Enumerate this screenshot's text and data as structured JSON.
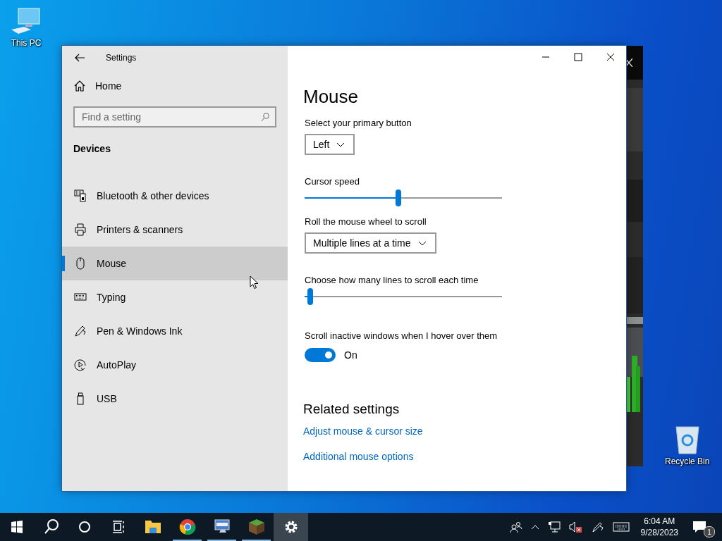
{
  "desktop_icons": [
    {
      "label": "This PC"
    },
    {
      "label": "Recycle Bin"
    }
  ],
  "window": {
    "title": "Settings",
    "home": "Home",
    "search": {
      "placeholder": "Find a setting"
    },
    "section": "Devices",
    "nav": [
      {
        "label": "Bluetooth & other devices",
        "selected": false
      },
      {
        "label": "Printers & scanners",
        "selected": false
      },
      {
        "label": "Mouse",
        "selected": true
      },
      {
        "label": "Typing",
        "selected": false
      },
      {
        "label": "Pen & Windows Ink",
        "selected": false
      },
      {
        "label": "AutoPlay",
        "selected": false
      },
      {
        "label": "USB",
        "selected": false
      }
    ]
  },
  "page": {
    "title": "Mouse",
    "settings": [
      {
        "kind": "dropdown",
        "label": "Select your primary button",
        "value": "Left"
      },
      {
        "kind": "slider",
        "label": "Cursor speed",
        "level": 0.475
      },
      {
        "kind": "dropdown",
        "label": "Roll the mouse wheel to scroll",
        "value": "Multiple lines at a time"
      },
      {
        "kind": "slider",
        "label": "Choose how many lines to scroll each time",
        "level": 0.03
      },
      {
        "kind": "toggle",
        "label": "Scroll inactive windows when I hover over them",
        "on": true,
        "state_text": "On"
      }
    ],
    "related_title": "Related settings",
    "related_links": [
      "Adjust mouse & cursor size",
      "Additional mouse options"
    ]
  },
  "taskbar": {
    "apps": [
      {
        "running": false,
        "active": false
      },
      {
        "running": true,
        "active": false
      },
      {
        "running": true,
        "active": false
      },
      {
        "running": true,
        "active": false
      },
      {
        "running": true,
        "active": true
      }
    ],
    "time": "6:04 AM",
    "date": "9/28/2023",
    "notifications": "1"
  }
}
